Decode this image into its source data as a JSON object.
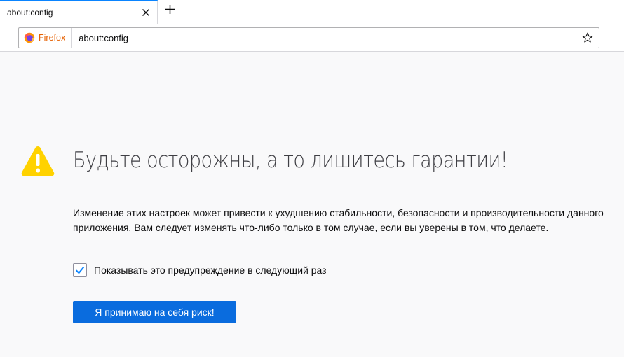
{
  "tab": {
    "title": "about:config"
  },
  "urlbar": {
    "identity_label": "Firefox",
    "url": "about:config"
  },
  "warning": {
    "title": "Будьте осторожны, а то лишитесь гарантии!",
    "description": "Изменение этих настроек может привести к ухудшению стабильности, безопасности и производительности данного приложения. Вам следует изменять что-либо только в том случае, если вы уверены в том, что делаете.",
    "checkbox_label": "Показывать это предупреждение в следующий раз",
    "checkbox_checked": true,
    "accept_button": "Я принимаю на себя риск!"
  },
  "icons": {
    "tab_close": "close-icon",
    "new_tab": "plus-icon",
    "browser": "firefox-icon",
    "bookmark": "star-icon",
    "warning": "warning-icon",
    "checkbox": "checkmark-icon"
  },
  "colors": {
    "accent": "#0a84ff",
    "button": "#0a6cde",
    "warning": "#ffd200",
    "identity": "#e66000"
  }
}
